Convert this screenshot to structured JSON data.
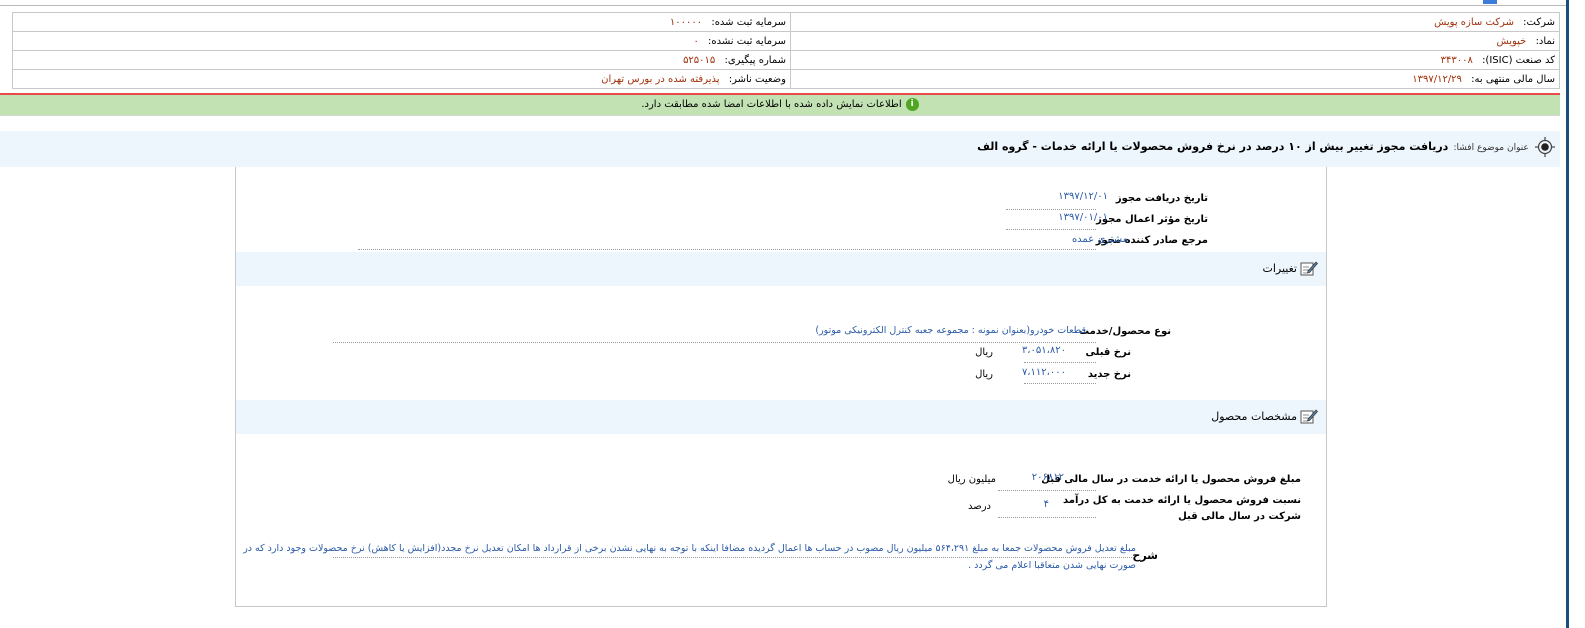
{
  "company_info": {
    "company_label": "شرکت:",
    "company_value": "شرکت سازه پویش",
    "symbol_label": "نماد:",
    "symbol_value": "خپویش",
    "isic_label": "کد صنعت (ISIC):",
    "isic_value": "۳۴۳۰۰۸",
    "fiscal_year_label": "سال مالی منتهی به:",
    "fiscal_year_value": "۱۳۹۷/۱۲/۲۹",
    "registered_capital_label": "سرمایه ثبت شده:",
    "registered_capital_value": "۱۰۰۰۰۰",
    "unregistered_capital_label": "سرمایه ثبت نشده:",
    "unregistered_capital_value": "۰",
    "tracking_label": "شماره پیگیری:",
    "tracking_value": "۵۲۵۰۱۵",
    "publisher_status_label": "وضعیت ناشر:",
    "publisher_status_value": "پذیرفته شده در بورس تهران"
  },
  "alert": {
    "icon": "info-icon",
    "text": "اطلاعات نمایش داده شده با اطلاعات امضا شده مطابقت دارد."
  },
  "subject": {
    "icon": "target-icon",
    "label": "عنوان موضوع افشا:",
    "title": "دریافت مجوز تغییر بیش از ۱۰ درصد در نرخ فروش محصولات یا ارائه خدمات - گروه الف"
  },
  "license": {
    "receive_date_label": "تاریخ دریافت مجوز",
    "receive_date_value": "۱۳۹۷/۱۲/۰۱",
    "effective_date_label": "تاریخ مؤثر اعمال مجوز",
    "effective_date_value": "۱۳۹۷/۰۱/۰۱",
    "issuer_label": "مرجع صادر کننده مجوز",
    "issuer_value": "مشتری عمده"
  },
  "changes": {
    "section_title": "تغییرات",
    "icon": "edit-icon",
    "product_type_label": "نوع محصول/خدمت",
    "product_type_value": "قطعات خودرو(بعنوان نمونه : مجموعه جعبه کنترل الکترونیکی موتور)",
    "previous_rate_label": "نرخ قبلی",
    "previous_rate_value": "۳،۰۵۱،۸۲۰",
    "previous_rate_unit": "ریال",
    "new_rate_label": "نرخ جدید",
    "new_rate_value": "۷،۱۱۲،۰۰۰",
    "new_rate_unit": "ریال"
  },
  "product_specs": {
    "section_title": "مشخصات محصول",
    "icon": "edit-icon",
    "sales_amount_label": "مبلغ فروش محصول یا ارائه خدمت در سال مالی قبل",
    "sales_amount_value": "۲۰۶۸۱۲",
    "sales_amount_unit": "میلیون ریال",
    "sales_ratio_label_line1": "نسبت فروش محصول یا ارائه خدمت به کل درآمد",
    "sales_ratio_label_line2": "شرکت در سال مالی قبل",
    "sales_ratio_value": "۴",
    "sales_ratio_unit": "درصد",
    "description_label": "شرح",
    "description_line1": "مبلغ تعدیل فروش محصولات جمعا به مبلغ ۵۶۴،۲۹۱ میلیون ریال مصوب در حساب ها اعمال گردیده مضافا اینکه با توجه به نهایی نشدن برخی از قرارداد ها امکان تعدیل نرخ مجدد(افزایش یا کاهش) نرخ محصولات وجود دارد که در",
    "description_line2": "صورت نهایی شدن متعاقبا اعلام می گردد ."
  }
}
